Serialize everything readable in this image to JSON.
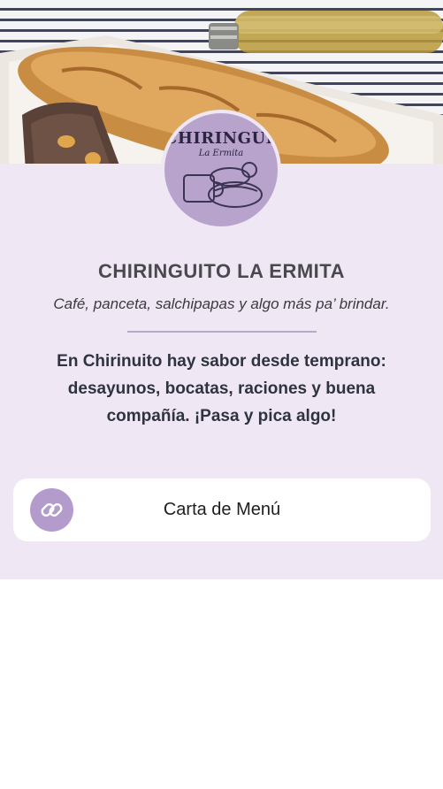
{
  "brand": {
    "logo_text": "CHIRINGUITO",
    "logo_subtext": "La Ermita",
    "name": "CHIRINGUITO LA ERMITA",
    "tagline": "Café, panceta, salchipapas y algo más pa’ brindar."
  },
  "description": "En Chirinuito hay sabor desde temprano: desayunos, bocatas, raciones y buena compañía. ¡Pasa y pica algo!",
  "links": [
    {
      "label": "Carta de Menú",
      "icon": "link-icon"
    }
  ],
  "colors": {
    "panel_bg": "#efe8f4",
    "accent": "#b39ccc",
    "card_bg": "#ffffff"
  }
}
